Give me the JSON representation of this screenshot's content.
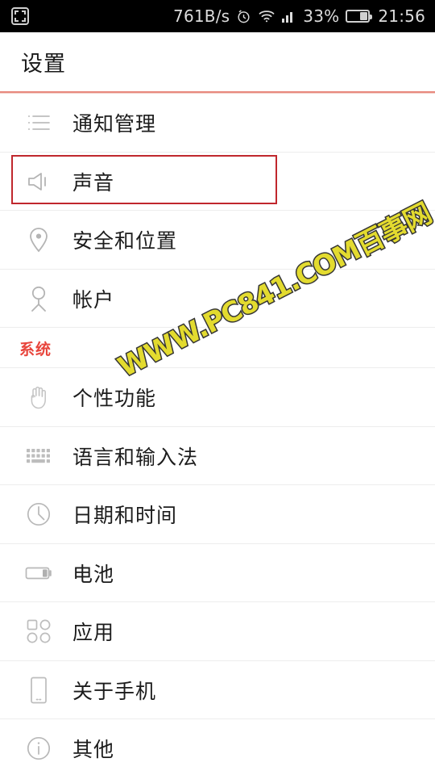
{
  "statusbar": {
    "fullscreen_icon": "fullscreen-icon",
    "net_speed": "761B/s",
    "alarm_icon": "alarm-icon",
    "wifi_icon": "wifi-icon",
    "signal_icon": "signal-bars-icon",
    "battery_percent": "33%",
    "battery_icon": "battery-icon",
    "time": "21:56"
  },
  "header": {
    "title": "设置",
    "accent_color": "#e8897e"
  },
  "annotation": {
    "highlight_color": "#c0272d",
    "highlighted_row": "声音"
  },
  "watermark": {
    "text": "WWW.PC841.COM百事网",
    "fill_color": "#e2da24",
    "stroke_color": "#2b2b2b"
  },
  "list": {
    "items": [
      {
        "label": "通知管理",
        "icon": "list-lines-icon"
      },
      {
        "label": "声音",
        "icon": "speaker-icon"
      },
      {
        "label": "安全和位置",
        "icon": "location-pin-icon"
      },
      {
        "label": "帐户",
        "icon": "person-icon"
      }
    ],
    "section": {
      "label": "系统",
      "color": "#e8453c",
      "items": [
        {
          "label": "个性功能",
          "icon": "hand-icon"
        },
        {
          "label": "语言和输入法",
          "icon": "keyboard-icon"
        },
        {
          "label": "日期和时间",
          "icon": "clock-icon"
        },
        {
          "label": "电池",
          "icon": "battery-horizontal-icon"
        },
        {
          "label": "应用",
          "icon": "apps-grid-icon"
        },
        {
          "label": "关于手机",
          "icon": "phone-icon"
        },
        {
          "label": "其他",
          "icon": "info-circle-icon"
        }
      ]
    }
  }
}
